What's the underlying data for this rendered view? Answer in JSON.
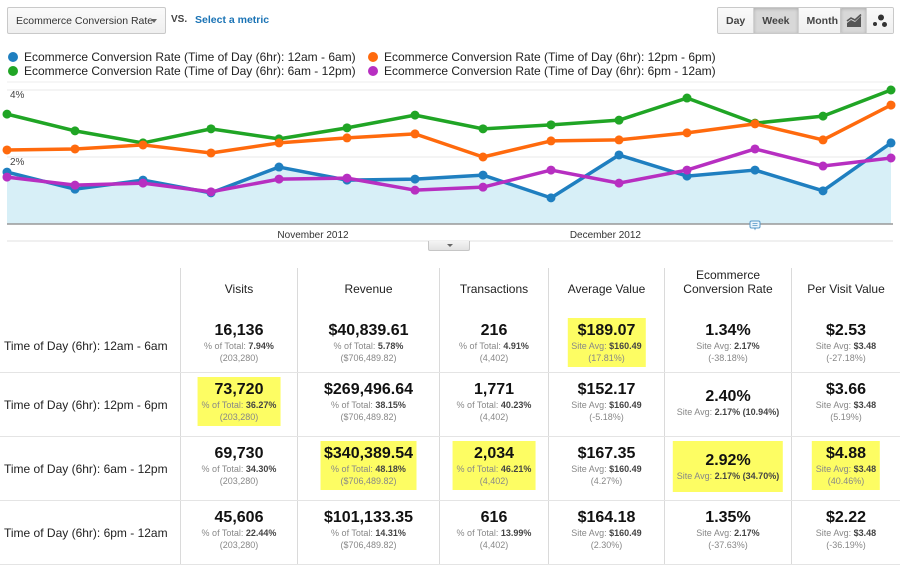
{
  "toolbar": {
    "metric_select": "Ecommerce Conversion Rate",
    "vs_label": "VS.",
    "select_metric_link": "Select a metric",
    "period_buttons": [
      {
        "label": "Day",
        "active": false
      },
      {
        "label": "Week",
        "active": true
      },
      {
        "label": "Month",
        "active": false
      }
    ],
    "chart_type_buttons": [
      {
        "icon": "line-chart-icon",
        "active": true
      },
      {
        "icon": "motion-chart-icon",
        "active": false
      }
    ]
  },
  "legend": [
    {
      "label": "Ecommerce Conversion Rate (Time of Day (6hr): 12am - 6am)",
      "color": "#1f7fc0"
    },
    {
      "label": "Ecommerce Conversion Rate (Time of Day (6hr): 12pm - 6pm)",
      "color": "#ff6a0d"
    },
    {
      "label": "Ecommerce Conversion Rate (Time of Day (6hr): 6am - 12pm)",
      "color": "#20a525"
    },
    {
      "label": "Ecommerce Conversion Rate (Time of Day (6hr): 6pm - 12am)",
      "color": "#b72fc1"
    }
  ],
  "chart_data": {
    "type": "line",
    "title": "",
    "xlabel": "",
    "ylabel": "Ecommerce Conversion Rate",
    "ylim": [
      0,
      4
    ],
    "y_ticks": [
      "4%",
      "2%"
    ],
    "y_tick_values": [
      4,
      2
    ],
    "x_month_labels": [
      {
        "label": "November 2012",
        "at_index": 4.5
      },
      {
        "label": "December 2012",
        "at_index": 8.8
      }
    ],
    "grid": true,
    "num_points": 14,
    "area_fill_series": 0,
    "area_fill_color": "#d7eff7",
    "series": [
      {
        "name": "12am - 6am",
        "color": "#1f7fc0",
        "values": [
          1.55,
          1.04,
          1.31,
          0.93,
          1.7,
          1.31,
          1.34,
          1.46,
          0.78,
          2.06,
          1.43,
          1.61,
          0.99,
          2.42
        ]
      },
      {
        "name": "12pm - 6pm",
        "color": "#ff6a0d",
        "values": [
          2.21,
          2.24,
          2.36,
          2.12,
          2.42,
          2.57,
          2.69,
          2.0,
          2.48,
          2.51,
          2.72,
          2.99,
          2.51,
          3.55
        ]
      },
      {
        "name": "6am - 12pm",
        "color": "#20a525",
        "values": [
          3.28,
          2.78,
          2.42,
          2.84,
          2.54,
          2.87,
          3.25,
          2.84,
          2.96,
          3.1,
          3.76,
          3.01,
          3.22,
          4.0
        ]
      },
      {
        "name": "6pm - 12am",
        "color": "#b72fc1",
        "values": [
          1.4,
          1.16,
          1.22,
          0.96,
          1.34,
          1.37,
          1.01,
          1.1,
          1.61,
          1.22,
          1.61,
          2.24,
          1.73,
          1.97
        ]
      }
    ],
    "annotation_marker_index": 11
  },
  "table": {
    "headers": [
      "Visits",
      "Revenue",
      "Transactions",
      "Average Value",
      "Ecommerce Conversion Rate",
      "Per Visit Value"
    ],
    "rows": [
      {
        "label": "Time of Day (6hr): 12am - 6am",
        "cells": [
          {
            "main": "16,136",
            "sub1_label": "% of Total: ",
            "sub1_value": "7.94%",
            "sub2": "(203,280)",
            "highlight": false
          },
          {
            "main": "$40,839.61",
            "sub1_label": "% of Total: ",
            "sub1_value": "5.78%",
            "sub2": "($706,489.82)",
            "highlight": false
          },
          {
            "main": "216",
            "sub1_label": "% of Total: ",
            "sub1_value": "4.91%",
            "sub2": "(4,402)",
            "highlight": false
          },
          {
            "main": "$189.07",
            "sub1_label": "Site Avg: ",
            "sub1_value": "$160.49",
            "sub2": "(17.81%)",
            "highlight": true
          },
          {
            "main": "1.34%",
            "sub1_label": "Site Avg: ",
            "sub1_value": "2.17%",
            "sub2": "(-38.18%)",
            "highlight": false
          },
          {
            "main": "$2.53",
            "sub1_label": "Site Avg: ",
            "sub1_value": "$3.48",
            "sub2": "(-27.18%)",
            "highlight": false
          }
        ]
      },
      {
        "label": "Time of Day (6hr): 12pm - 6pm",
        "cells": [
          {
            "main": "73,720",
            "sub1_label": "% of Total: ",
            "sub1_value": "36.27%",
            "sub2": "(203,280)",
            "highlight": true
          },
          {
            "main": "$269,496.64",
            "sub1_label": "% of Total: ",
            "sub1_value": "38.15%",
            "sub2": "($706,489.82)",
            "highlight": false
          },
          {
            "main": "1,771",
            "sub1_label": "% of Total: ",
            "sub1_value": "40.23%",
            "sub2": "(4,402)",
            "highlight": false
          },
          {
            "main": "$152.17",
            "sub1_label": "Site Avg: ",
            "sub1_value": "$160.49",
            "sub2": "(-5.18%)",
            "highlight": false
          },
          {
            "main": "2.40%",
            "sub1_label": "Site Avg: ",
            "sub1_value": "2.17% (10.94%)",
            "sub2": "",
            "highlight": false
          },
          {
            "main": "$3.66",
            "sub1_label": "Site Avg: ",
            "sub1_value": "$3.48",
            "sub2": "(5.19%)",
            "highlight": false
          }
        ]
      },
      {
        "label": "Time of Day (6hr): 6am - 12pm",
        "cells": [
          {
            "main": "69,730",
            "sub1_label": "% of Total: ",
            "sub1_value": "34.30%",
            "sub2": "(203,280)",
            "highlight": false
          },
          {
            "main": "$340,389.54",
            "sub1_label": "% of Total: ",
            "sub1_value": "48.18%",
            "sub2": "($706,489.82)",
            "highlight": true
          },
          {
            "main": "2,034",
            "sub1_label": "% of Total: ",
            "sub1_value": "46.21%",
            "sub2": "(4,402)",
            "highlight": true
          },
          {
            "main": "$167.35",
            "sub1_label": "Site Avg: ",
            "sub1_value": "$160.49",
            "sub2": "(4.27%)",
            "highlight": false
          },
          {
            "main": "2.92%",
            "sub1_label": "Site Avg: ",
            "sub1_value": "2.17% (34.70%)",
            "sub2": "",
            "highlight": true
          },
          {
            "main": "$4.88",
            "sub1_label": "Site Avg: ",
            "sub1_value": "$3.48",
            "sub2": "(40.46%)",
            "highlight": true
          }
        ]
      },
      {
        "label": "Time of Day (6hr): 6pm - 12am",
        "cells": [
          {
            "main": "45,606",
            "sub1_label": "% of Total: ",
            "sub1_value": "22.44%",
            "sub2": "(203,280)",
            "highlight": false
          },
          {
            "main": "$101,133.35",
            "sub1_label": "% of Total: ",
            "sub1_value": "14.31%",
            "sub2": "($706,489.82)",
            "highlight": false
          },
          {
            "main": "616",
            "sub1_label": "% of Total: ",
            "sub1_value": "13.99%",
            "sub2": "(4,402)",
            "highlight": false
          },
          {
            "main": "$164.18",
            "sub1_label": "Site Avg: ",
            "sub1_value": "$160.49",
            "sub2": "(2.30%)",
            "highlight": false
          },
          {
            "main": "1.35%",
            "sub1_label": "Site Avg: ",
            "sub1_value": "2.17%",
            "sub2": "(-37.63%)",
            "highlight": false
          },
          {
            "main": "$2.22",
            "sub1_label": "Site Avg: ",
            "sub1_value": "$3.48",
            "sub2": "(-36.19%)",
            "highlight": false
          }
        ]
      }
    ]
  }
}
